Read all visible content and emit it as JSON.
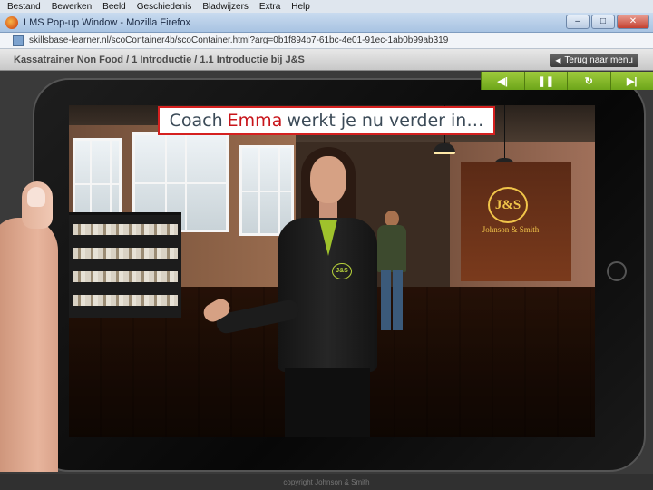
{
  "menu": [
    "Bestand",
    "Bewerken",
    "Beeld",
    "Geschiedenis",
    "Bladwijzers",
    "Extra",
    "Help"
  ],
  "window": {
    "title": "LMS Pop-up Window - Mozilla Firefox",
    "buttons": {
      "minimize": "–",
      "maximize": "□",
      "close": "✕"
    }
  },
  "address": {
    "url": "skillsbase-learner.nl/scoContainer4b/scoContainer.html?arg=0b1f894b7-61bc-4e01-91ec-1ab0b99ab319"
  },
  "course": {
    "breadcrumb": "Kassatrainer Non Food / 1 Introductie / 1.1 Introductie bij J&S",
    "back_label": "Terug naar menu"
  },
  "controls": [
    {
      "name": "rewind-button",
      "icon": "skip-back-icon",
      "glyph": "◀|"
    },
    {
      "name": "pause-button",
      "icon": "pause-icon",
      "glyph": "❚❚"
    },
    {
      "name": "replay-button",
      "icon": "replay-icon",
      "glyph": "↻"
    },
    {
      "name": "next-button",
      "icon": "skip-forward-icon",
      "glyph": "▶|"
    }
  ],
  "caption": {
    "prefix": "Coach",
    "highlight": "Emma",
    "suffix": "werkt je nu verder in…"
  },
  "scene": {
    "logo_text": "J&S",
    "brand_name": "Johnson & Smith",
    "emblem_text": "J&S"
  },
  "footer": {
    "copyright": "copyright Johnson & Smith"
  },
  "colors": {
    "accent_green": "#7fb526",
    "caption_highlight": "#c8141a",
    "caption_border": "#d5201f",
    "brand_gold": "#f1c54a"
  }
}
